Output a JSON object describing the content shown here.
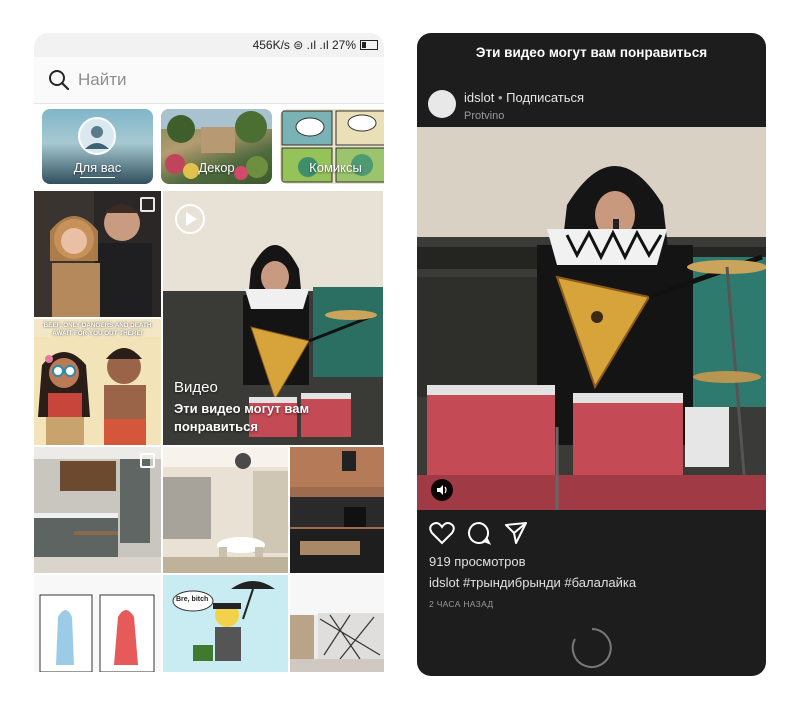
{
  "status_bar": {
    "text": "456K/s ⊜ .ıl .ıl 27%"
  },
  "search": {
    "placeholder": "Найти"
  },
  "chips": [
    {
      "label": "Для вас"
    },
    {
      "label": "Декор"
    },
    {
      "label": "Комиксы"
    }
  ],
  "grid": {
    "comic_text": "BEEF, ONLY DANGERS AND DEATH AWAIT FOR YOU OUT THERE!",
    "video_tile": {
      "kind": "Видео",
      "title": "Эти видео могут вам понравиться"
    },
    "speech_bubble": "Bre, bitch"
  },
  "player": {
    "title": "Эти видео могут вам понравиться",
    "username": "idslot",
    "separator": "•",
    "follow_label": "Подписаться",
    "location": "Protvino",
    "views": "919 просмотров",
    "caption_user": "idslot",
    "caption_text": "#трындибрынди #балалайка",
    "time": "2 ЧАСА НАЗАД"
  },
  "colors": {
    "accent_dark": "#1d1d1d",
    "drum_red": "#c44a55",
    "teal_wall": "#2f7a6e"
  }
}
